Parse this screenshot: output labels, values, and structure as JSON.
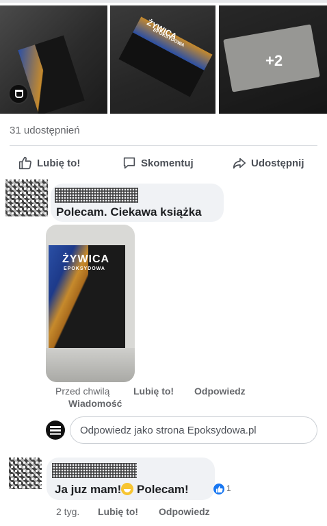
{
  "photos": {
    "book_title": "ŻYWICA",
    "book_subtitle": "EPOKSYDOWA",
    "more_count": "+2"
  },
  "post": {
    "shares_text": "31 udostępnień"
  },
  "actions": {
    "like": "Lubię to!",
    "comment": "Skomentuj",
    "share": "Udostępnij"
  },
  "comments": [
    {
      "text": "Polecam. Ciekawa książka",
      "attachment_title": "ŻYWICA",
      "attachment_subtitle": "EPOKSYDOWA",
      "time": "Przed chwilą",
      "like": "Lubię to!",
      "reply": "Odpowiedz",
      "message": "Wiadomość"
    },
    {
      "text_before": "Ja juz mam!",
      "text_after": " Polecam!",
      "reaction_count": "1",
      "time": "2 tyg.",
      "like": "Lubię to!",
      "reply": "Odpowiedz"
    }
  ],
  "reply_box": {
    "placeholder": "Odpowiedz jako strona Epoksydowa.pl"
  },
  "colors": {
    "accent": "#1877f2",
    "bubble": "#f0f2f5",
    "muted_text": "#65676b"
  },
  "icons": [
    "thumbs-up-icon",
    "comment-icon",
    "share-arrow-icon",
    "page-badge-icon",
    "grin-emoji-icon",
    "like-reaction-icon"
  ]
}
